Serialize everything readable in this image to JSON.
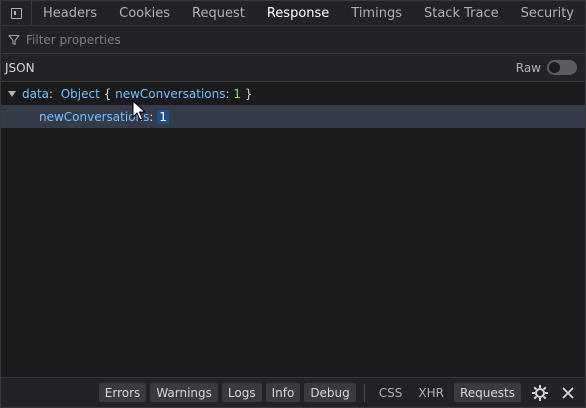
{
  "tabs": [
    {
      "label": "Headers"
    },
    {
      "label": "Cookies"
    },
    {
      "label": "Request"
    },
    {
      "label": "Response"
    },
    {
      "label": "Timings"
    },
    {
      "label": "Stack Trace"
    },
    {
      "label": "Security"
    }
  ],
  "active_tab": "Response",
  "filter": {
    "placeholder": "Filter properties",
    "value": ""
  },
  "json_header": {
    "label": "JSON",
    "raw_label": "Raw"
  },
  "tree": {
    "root_key": "data",
    "root_colon": ":",
    "root_summary_type": "Object",
    "root_summary_open": "{",
    "root_summary_key": "newConversations",
    "root_summary_colon": ":",
    "root_summary_value": "1",
    "root_summary_close": "}",
    "child_key": "newConversations",
    "child_colon": ":",
    "child_value": "1"
  },
  "bottom_bar": {
    "errors": "Errors",
    "warnings": "Warnings",
    "logs": "Logs",
    "info": "Info",
    "debug": "Debug",
    "css": "CSS",
    "xhr": "XHR",
    "requests": "Requests"
  },
  "icons": {
    "panel_toggle": "panel-toggle-icon",
    "filter": "filter-icon",
    "settings": "gear-icon",
    "close": "close-icon"
  },
  "colors": {
    "background": "#1b1b1d",
    "toolbar": "#232327",
    "key": "#75bfff",
    "number": "#86de74",
    "selected_row": "#353b48",
    "selected_value": "#204e8a"
  }
}
